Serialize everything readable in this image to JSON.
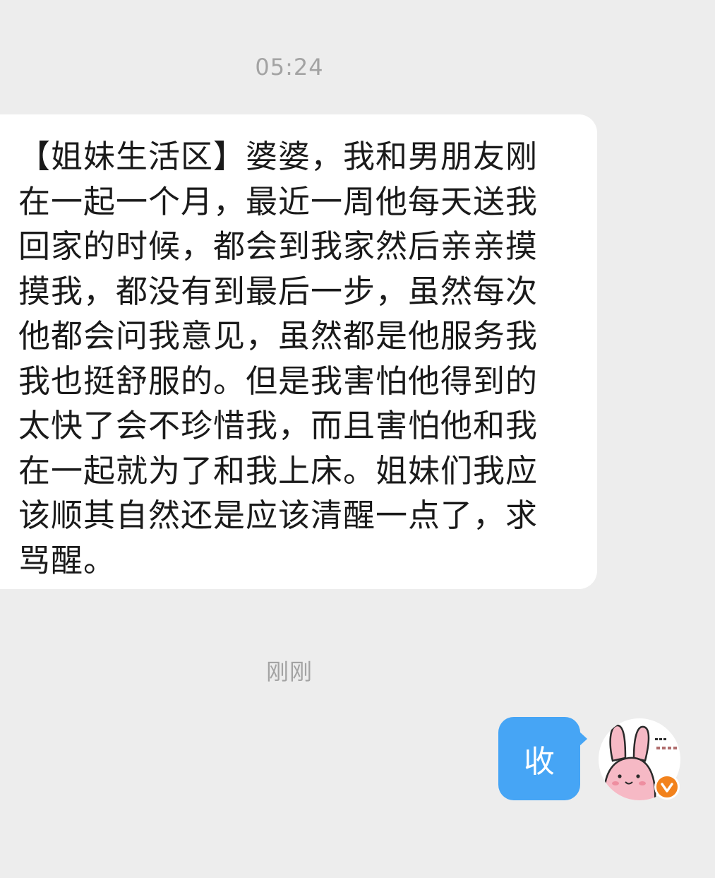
{
  "chat": {
    "timestamp_top": "05:24",
    "incoming_message": "【姐妹生活区】婆婆，我和男朋友刚在一起一个月，最近一周他每天送我回家的时候，都会到我家然后亲亲摸摸我，都没有到最后一步，虽然每次他都会问我意见，虽然都是他服务我我也挺舒服的。但是我害怕他得到的太快了会不珍惜我，而且害怕他和我在一起就为了和我上床。姐妹们我应该顺其自然还是应该清醒一点了，求骂醒。",
    "timestamp_bottom": "刚刚",
    "outgoing_message": "收"
  },
  "avatar": {
    "icon": "pink-bunny-avatar-icon",
    "badge_icon": "verified-check-icon"
  },
  "colors": {
    "background": "#ededed",
    "incoming_bubble": "#ffffff",
    "outgoing_bubble": "#46a5f5",
    "timestamp_text": "#a3a3a3",
    "badge": "#f2821c",
    "bunny_fill": "#f6b9c5"
  }
}
